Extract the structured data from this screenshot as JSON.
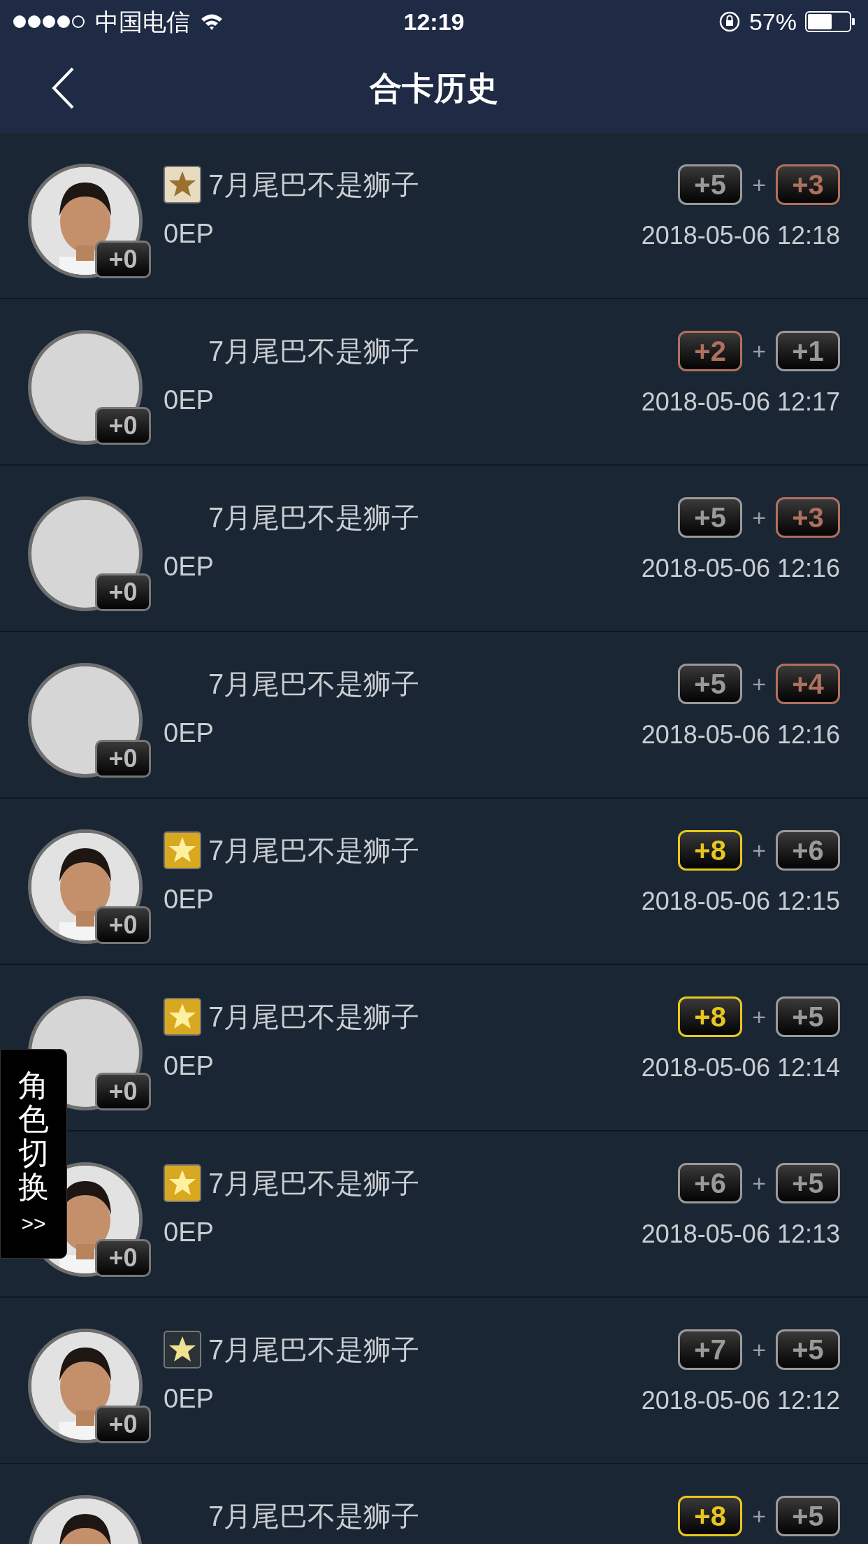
{
  "status_bar": {
    "carrier": "中国电信",
    "time": "12:19",
    "battery": "57%"
  },
  "nav": {
    "title": "合卡历史"
  },
  "rows": [
    {
      "photo": true,
      "star": {
        "color": "#e8dcc0"
      },
      "name": "7月尾巴不是狮子",
      "avatar_badge": "+0",
      "ep": "0EP",
      "badges": [
        {
          "text": "+5",
          "color": "#9a9a9a"
        },
        {
          "text": "+3",
          "color": "#b0705e"
        }
      ],
      "plus": "+",
      "time": "2018-05-06 12:18"
    },
    {
      "photo": false,
      "name": "7月尾巴不是狮子",
      "avatar_badge": "+0",
      "ep": "0EP",
      "badges": [
        {
          "text": "+2",
          "color": "#b0705e"
        },
        {
          "text": "+1",
          "color": "#9a9a9a"
        }
      ],
      "plus": "+",
      "time": "2018-05-06 12:17"
    },
    {
      "photo": false,
      "name": "7月尾巴不是狮子",
      "avatar_badge": "+0",
      "ep": "0EP",
      "badges": [
        {
          "text": "+5",
          "color": "#9a9a9a"
        },
        {
          "text": "+3",
          "color": "#b0705e"
        }
      ],
      "plus": "+",
      "time": "2018-05-06 12:16"
    },
    {
      "photo": false,
      "name": "7月尾巴不是狮子",
      "avatar_badge": "+0",
      "ep": "0EP",
      "badges": [
        {
          "text": "+5",
          "color": "#9a9a9a"
        },
        {
          "text": "+4",
          "color": "#b0705e"
        }
      ],
      "plus": "+",
      "time": "2018-05-06 12:16"
    },
    {
      "photo": true,
      "star": {
        "color": "#d8a820"
      },
      "name": "7月尾巴不是狮子",
      "avatar_badge": "+0",
      "ep": "0EP",
      "badges": [
        {
          "text": "+8",
          "color": "#e8c620"
        },
        {
          "text": "+6",
          "color": "#9a9a9a"
        }
      ],
      "plus": "+",
      "time": "2018-05-06 12:15"
    },
    {
      "photo": false,
      "star": {
        "color": "#d8a820"
      },
      "name": "7月尾巴不是狮子",
      "avatar_badge": "+0",
      "ep": "0EP",
      "badges": [
        {
          "text": "+8",
          "color": "#e8c620"
        },
        {
          "text": "+5",
          "color": "#9a9a9a"
        }
      ],
      "plus": "+",
      "time": "2018-05-06 12:14"
    },
    {
      "photo": true,
      "star": {
        "color": "#d8a820"
      },
      "name": "7月尾巴不是狮子",
      "avatar_badge": "+0",
      "ep": "0EP",
      "badges": [
        {
          "text": "+6",
          "color": "#9a9a9a"
        },
        {
          "text": "+5",
          "color": "#9a9a9a"
        }
      ],
      "plus": "+",
      "time": "2018-05-06 12:13"
    },
    {
      "photo": true,
      "star": {
        "color": "#2a3238"
      },
      "name": "7月尾巴不是狮子",
      "avatar_badge": "+0",
      "ep": "0EP",
      "badges": [
        {
          "text": "+7",
          "color": "#9a9a9a"
        },
        {
          "text": "+5",
          "color": "#9a9a9a"
        }
      ],
      "plus": "+",
      "time": "2018-05-06 12:12"
    },
    {
      "photo": true,
      "name": "7月尾巴不是狮子",
      "badges": [
        {
          "text": "+8",
          "color": "#e8c620"
        },
        {
          "text": "+5",
          "color": "#9a9a9a"
        }
      ],
      "plus": "+"
    }
  ],
  "side_tab": {
    "label": "角色切换",
    "arrow": ">>"
  }
}
